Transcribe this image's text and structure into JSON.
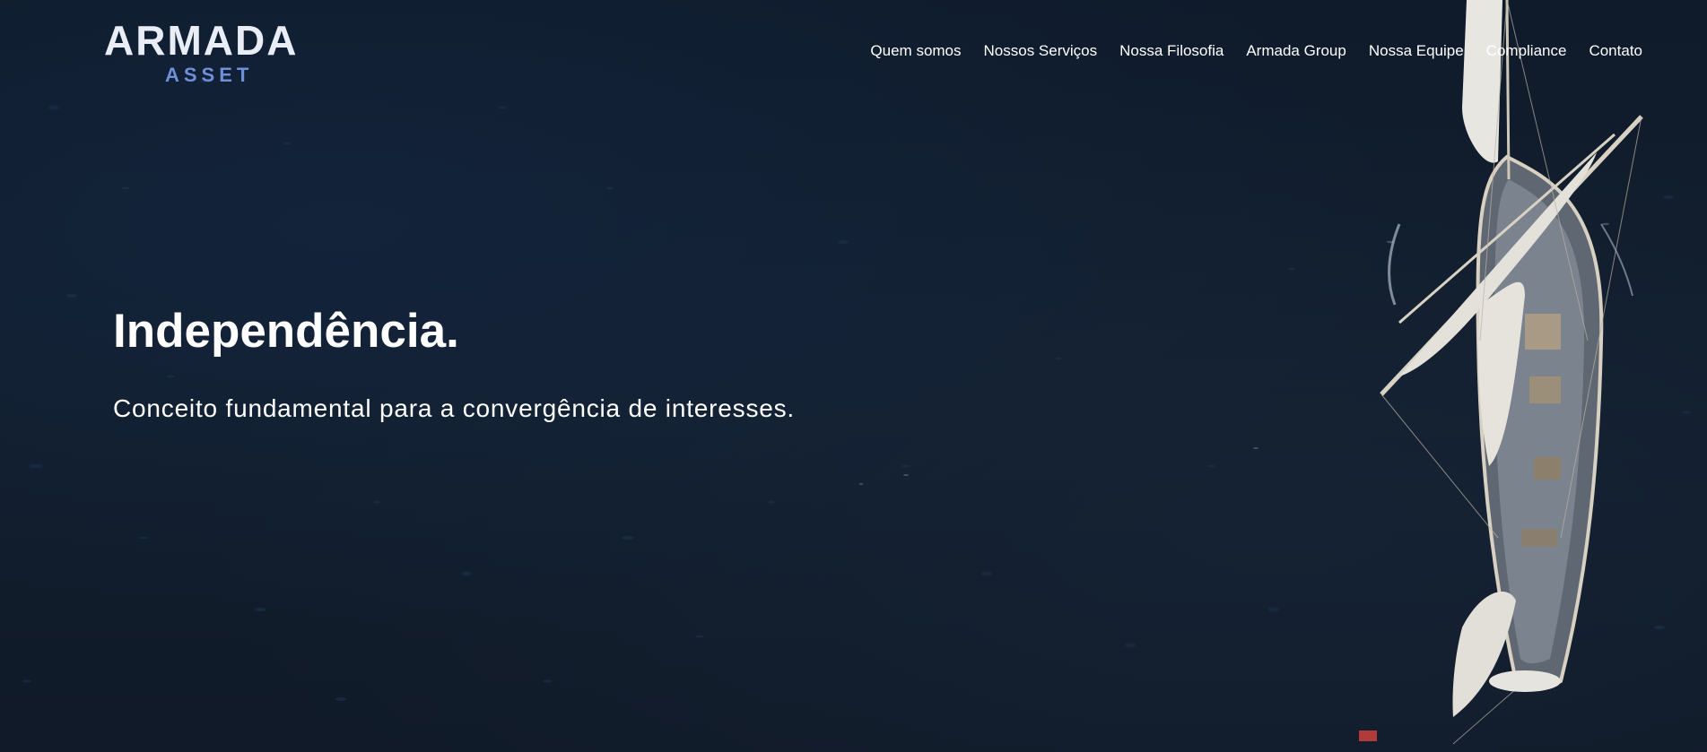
{
  "brand": {
    "name": "ARMADA",
    "tagline": "ASSET"
  },
  "nav": {
    "items": [
      {
        "label": "Quem somos"
      },
      {
        "label": "Nossos Serviços"
      },
      {
        "label": "Nossa Filosofia"
      },
      {
        "label": "Armada Group"
      },
      {
        "label": "Nossa Equipe"
      },
      {
        "label": "Compliance"
      },
      {
        "label": "Contato"
      }
    ]
  },
  "hero": {
    "headline": "Independência.",
    "subheadline": "Conceito fundamental para a convergência de interesses.",
    "background_image": "aerial-sailing-ship-on-dark-ocean"
  },
  "colors": {
    "background": "#0f1a28",
    "text": "#ffffff",
    "logo_main": "#e9eef6",
    "logo_accent": "#6f8fd8"
  }
}
